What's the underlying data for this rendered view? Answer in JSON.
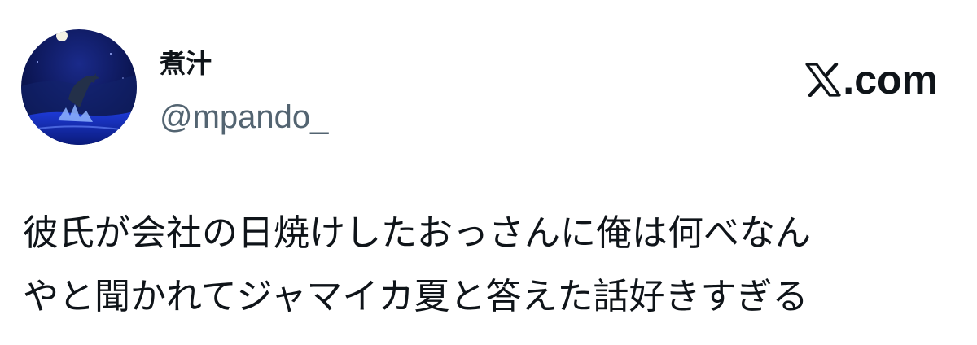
{
  "author": {
    "display_name": "煮汁",
    "handle": "@mpando_",
    "avatar_icon": "night-ocean-dolphin-avatar"
  },
  "brand": {
    "icon": "x-logo-icon",
    "suffix": ".com"
  },
  "tweet": {
    "lines": [
      "彼氏が会社の日焼けしたおっさんに俺は何べなん",
      "やと聞かれてジャマイカ夏と答えた話好きすぎる"
    ]
  },
  "colors": {
    "text": "#0f1419",
    "secondary_text": "#536471",
    "background": "#ffffff"
  }
}
